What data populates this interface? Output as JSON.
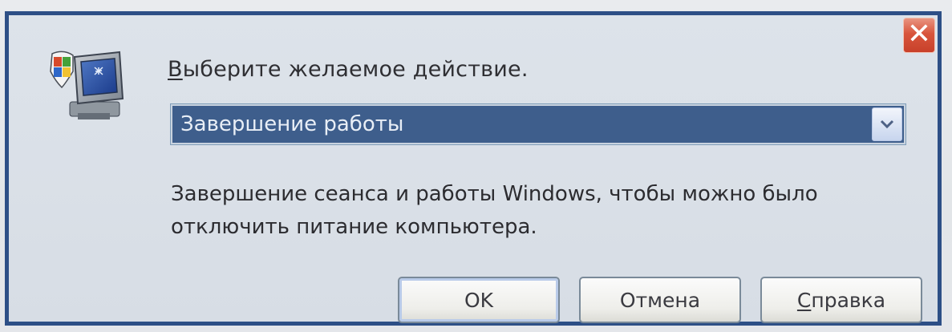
{
  "dialog": {
    "prompt_prefix": "В",
    "prompt_rest": "ыберите желаемое действие.",
    "close_label": "✕",
    "action_select": {
      "selected": "Завершение работы"
    },
    "description_line1": "Завершение сеанса и работы Windows, чтобы можно было",
    "description_line2": "отключить питание компьютера.",
    "buttons": {
      "ok": "OK",
      "cancel": "Отмена",
      "help_prefix": "С",
      "help_rest": "правка"
    }
  },
  "icons": {
    "app": "computer-with-windows-shield-icon",
    "dropdown": "chevron-down-icon",
    "close": "close-icon"
  },
  "colors": {
    "frame_border": "#2d4f86",
    "close_button": "#d8553c",
    "select_highlight": "#3e5e8c"
  }
}
